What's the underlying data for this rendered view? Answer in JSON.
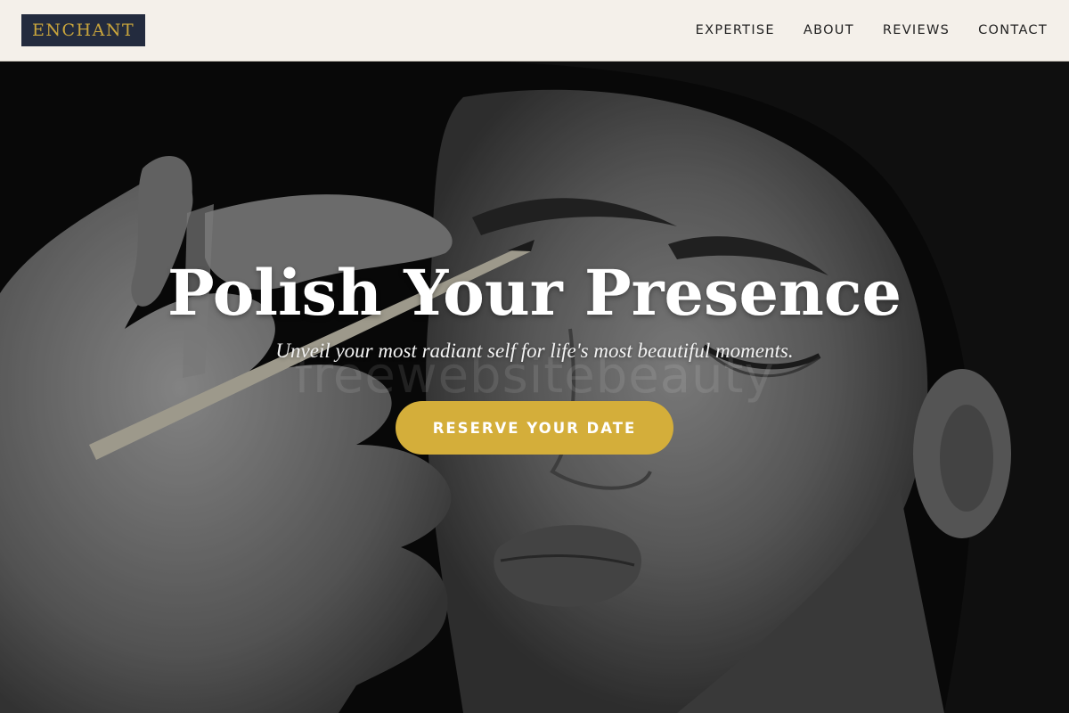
{
  "brand": {
    "logo_text": "ENCHANT",
    "accent_color": "#d4ae3a",
    "logo_bg": "#232b3e"
  },
  "nav": {
    "items": [
      {
        "label": "EXPERTISE"
      },
      {
        "label": "ABOUT"
      },
      {
        "label": "REVIEWS"
      },
      {
        "label": "CONTACT"
      }
    ]
  },
  "hero": {
    "title": "Polish Your Presence",
    "subtitle": "Unveil your most radiant self for life's most beautiful moments.",
    "cta_label": "RESERVE YOUR DATE",
    "watermark": "freewebsitebeauty",
    "image": "black-and-white photo of makeup artist applying eyeliner to a woman's eyebrow"
  }
}
